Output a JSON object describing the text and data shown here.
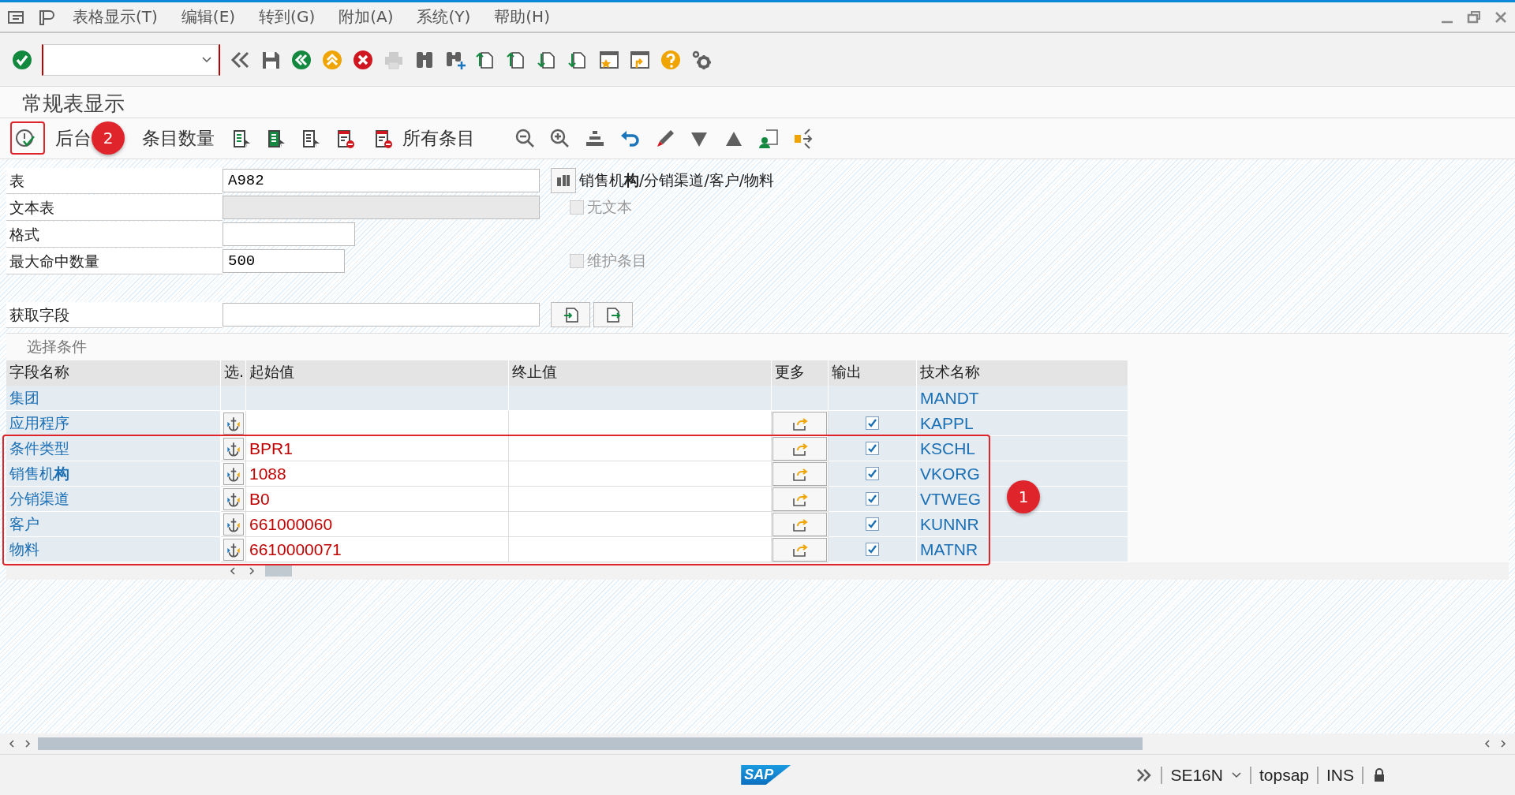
{
  "menu_bar": {
    "items": [
      {
        "label": "表格显示(T)"
      },
      {
        "label": "编辑(E)"
      },
      {
        "label": "转到(G)"
      },
      {
        "label": "附加(A)"
      },
      {
        "label": "系统(Y)"
      },
      {
        "label": "帮助(H)"
      }
    ]
  },
  "screen_title": "常规表显示",
  "app_toolbar": {
    "background_label": "后台",
    "count_label": "条目数量",
    "all_entries_label": "所有条目"
  },
  "form": {
    "fields": [
      {
        "kind": "input",
        "label": "表",
        "value": "A982"
      },
      {
        "kind": "disabled",
        "label": "文本表"
      },
      {
        "kind": "input",
        "label": "格式"
      },
      {
        "kind": "input",
        "label": "最大命中数量",
        "value": "500"
      },
      {
        "kind": "input",
        "label": "获取字段"
      }
    ],
    "table_description": "销售机**构**/分销渠道/客户/物料",
    "checkboxes": [
      {
        "label": "无文本",
        "checked": false,
        "disabled": true
      },
      {
        "label": "维护条目",
        "checked": false,
        "disabled": true
      }
    ]
  },
  "selection": {
    "title": "选择条件",
    "columns": [
      "字段名称",
      "选.",
      "起始值",
      "终止值",
      "更多",
      "输出",
      "技术名称"
    ],
    "rows": [
      {
        "kind": "fixed",
        "field": "集团",
        "tech_name": "MANDT"
      },
      {
        "kind": "input",
        "field": "应用程序",
        "output": true,
        "tech_name": "KAPPL"
      },
      {
        "kind": "input",
        "field": "条件类型",
        "from": "BPR1",
        "output": true,
        "tech_name": "KSCHL"
      },
      {
        "kind": "input",
        "field": "销售机**构**",
        "from": "1088",
        "output": true,
        "tech_name": "VKORG"
      },
      {
        "kind": "input",
        "field": "分销渠道",
        "from": "B0",
        "output": true,
        "tech_name": "VTWEG"
      },
      {
        "kind": "input",
        "field": "客户",
        "from": "661000060",
        "output": true,
        "tech_name": "KUNNR"
      },
      {
        "kind": "input",
        "field": "物料",
        "from": "6610000071",
        "output": true,
        "tech_name": "MATNR"
      }
    ]
  },
  "annotations": [
    {
      "label": "1"
    },
    {
      "label": "2"
    }
  ],
  "status_bar": {
    "logo": "SAP",
    "transaction": "SE16N",
    "system": "topsap",
    "mode": "INS"
  }
}
